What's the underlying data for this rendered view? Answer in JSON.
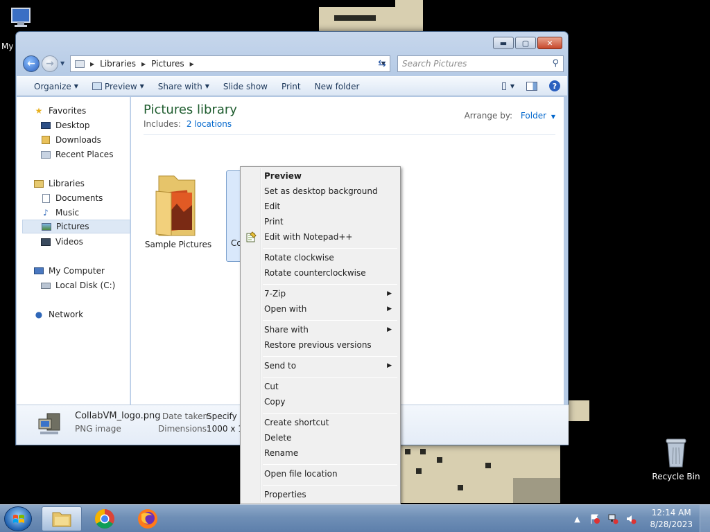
{
  "desktop": {
    "icons": [
      {
        "label": "My"
      },
      {
        "label": "Recycle Bin"
      }
    ]
  },
  "window": {
    "address": {
      "crumbs": [
        "Libraries",
        "Pictures"
      ]
    },
    "search": {
      "placeholder": "Search Pictures"
    },
    "toolbar": {
      "items": [
        "Organize",
        "Preview",
        "Share with",
        "Slide show",
        "Print",
        "New folder"
      ]
    },
    "nav": {
      "favorites": "Favorites",
      "desktop": "Desktop",
      "downloads": "Downloads",
      "recent": "Recent Places",
      "libraries": "Libraries",
      "documents": "Documents",
      "music": "Music",
      "pictures": "Pictures",
      "videos": "Videos",
      "computer": "My Computer",
      "localdisk": "Local Disk (C:)",
      "network": "Network"
    },
    "library": {
      "title": "Pictures library",
      "includes_label": "Includes:",
      "includes_link": "2 locations",
      "arrange_label": "Arrange by:",
      "arrange_value": "Folder"
    },
    "items": [
      {
        "name": "Sample Pictures"
      },
      {
        "name": "Co"
      }
    ],
    "details": {
      "filename": "CollabVM_logo.png",
      "type": "PNG image",
      "date_label": "Date taken:",
      "date_value": "Specify d",
      "dim_label": "Dimensions:",
      "dim_value": "1000 x 100"
    }
  },
  "context_menu": {
    "items": [
      {
        "label": "Preview"
      },
      {
        "label": "Set as desktop background"
      },
      {
        "label": "Edit"
      },
      {
        "label": "Print"
      },
      {
        "label": "Edit with Notepad++"
      },
      {
        "label": "Rotate clockwise"
      },
      {
        "label": "Rotate counterclockwise"
      },
      {
        "label": "7-Zip"
      },
      {
        "label": "Open with"
      },
      {
        "label": "Share with"
      },
      {
        "label": "Restore previous versions"
      },
      {
        "label": "Send to"
      },
      {
        "label": "Cut"
      },
      {
        "label": "Copy"
      },
      {
        "label": "Create shortcut"
      },
      {
        "label": "Delete"
      },
      {
        "label": "Rename"
      },
      {
        "label": "Open file location"
      },
      {
        "label": "Properties"
      }
    ]
  },
  "taskbar": {
    "time": "12:14 AM",
    "date": "8/28/2023"
  }
}
